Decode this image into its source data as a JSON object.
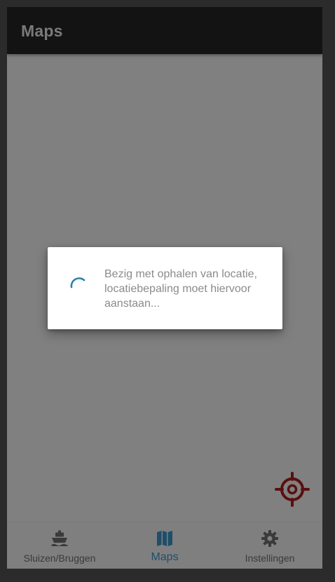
{
  "header": {
    "title": "Maps"
  },
  "dialog": {
    "message": "Bezig met ophalen van locatie, locatiebepaling moet hiervoor aanstaan...",
    "spinner_icon": "loading-spinner-icon"
  },
  "map": {
    "locate_icon": "crosshair-location-icon"
  },
  "bottom_nav": {
    "items": [
      {
        "label": "Sluizen/Bruggen",
        "icon": "ship-icon",
        "active": false
      },
      {
        "label": "Maps",
        "icon": "map-icon",
        "active": true
      },
      {
        "label": "Instellingen",
        "icon": "gear-icon",
        "active": false
      }
    ]
  },
  "colors": {
    "header_bg": "#131313",
    "overlay": "#808080",
    "accent_active": "#1f4e6b",
    "locate_icon": "#5a0f0f",
    "spinner": "#2e7fb0"
  }
}
